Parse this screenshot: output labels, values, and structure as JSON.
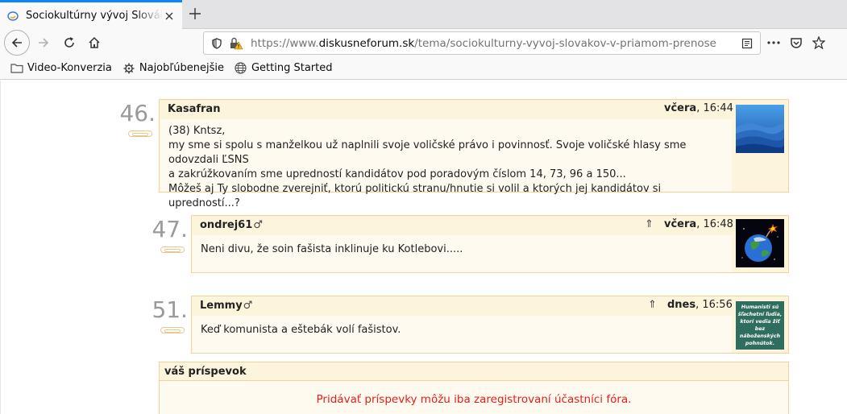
{
  "browser": {
    "tab_title": "Sociokultúrny vývoj Slovákov v priamom prenose",
    "url_scheme": "https://www.",
    "url_host": "diskusneforum.sk",
    "url_path": "/tema/sociokulturny-vyvoj-slovakov-v-priamom-prenose",
    "bookmarks": [
      {
        "label": "Video-Konverzia",
        "icon": "folder-icon"
      },
      {
        "label": "Najobľúbenejšie",
        "icon": "gear-icon"
      },
      {
        "label": "Getting Started",
        "icon": "globe-icon"
      }
    ]
  },
  "posts": [
    {
      "number": "46.",
      "author": "Kasafran",
      "gender": "",
      "time_day": "včera",
      "time_clock": ", 16:44",
      "lines": [
        "(38) Kntsz,",
        "my sme si spolu s manželkou už naplnili svoje voličské právo i povinnosť. Svoje voličské hlasy sme odovzdali ĽSNS",
        "a zakrúžkovaním sme upredností kandidátov pod poradovým číslom 14, 73, 96 a 150...",
        "Môžeš aj Ty slobodne zverejniť, ktorú politickú stranu/hnutie si volil a ktorých jej kandidátov si upredností...?"
      ],
      "avatar": "mountains-avatar"
    },
    {
      "number": "47.",
      "author": "ondrej61",
      "gender": "♂",
      "reply_arrow": "⇑",
      "time_day": "včera",
      "time_clock": ", 16:48",
      "lines": [
        "Neni divu, že soin fašista inklinuje ku Kotlebovi....."
      ],
      "avatar": "earth-bomb-avatar"
    },
    {
      "number": "51.",
      "author": "Lemmy",
      "gender": "♂",
      "reply_arrow": "⇑",
      "time_day": "dnes",
      "time_clock": ", 16:56",
      "lines": [
        "Keď komunista a eštebák volí fašistov."
      ],
      "avatar": "humanist-avatar",
      "avatar_text": [
        "Humanisti sú",
        "šľachetní ľudia,",
        "ktorí vedia žiť",
        "bez náboženských",
        "pohnútok."
      ]
    }
  ],
  "compose": {
    "title": "váš príspevok",
    "message": "Pridávať príspevky môžu iba zaregistrovaní účastníci fóra."
  },
  "colors": {
    "post_border": "#f2d39a",
    "post_header_bg": "#fdf4dc",
    "post_body_bg": "#fffaf0",
    "error_text": "#e0201a",
    "tab_accent": "#0a84ff"
  }
}
